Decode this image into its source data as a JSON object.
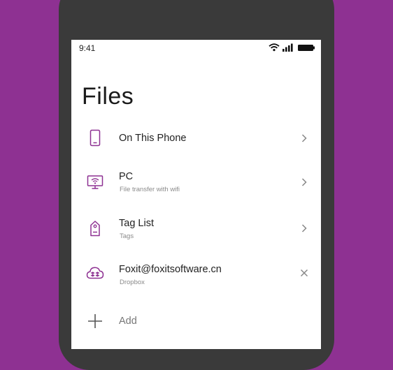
{
  "status_bar": {
    "time": "9:41"
  },
  "page": {
    "title": "Files"
  },
  "items": [
    {
      "label": "On This Phone",
      "subtitle": "",
      "icon": "phone-icon",
      "action": "chevron-right-icon"
    },
    {
      "label": "PC",
      "subtitle": "File transfer with wifi",
      "icon": "monitor-wifi-icon",
      "action": "chevron-right-icon"
    },
    {
      "label": "Tag List",
      "subtitle": "Tags",
      "icon": "tag-icon",
      "action": "chevron-right-icon"
    },
    {
      "label": "Foxit@foxitsoftware.cn",
      "subtitle": "Dropbox",
      "icon": "dropbox-cloud-icon",
      "action": "close-icon"
    }
  ],
  "add": {
    "label": "Add"
  },
  "colors": {
    "background": "#8e3192",
    "accent": "#8e3192",
    "phone_body": "#3a3a3a"
  }
}
